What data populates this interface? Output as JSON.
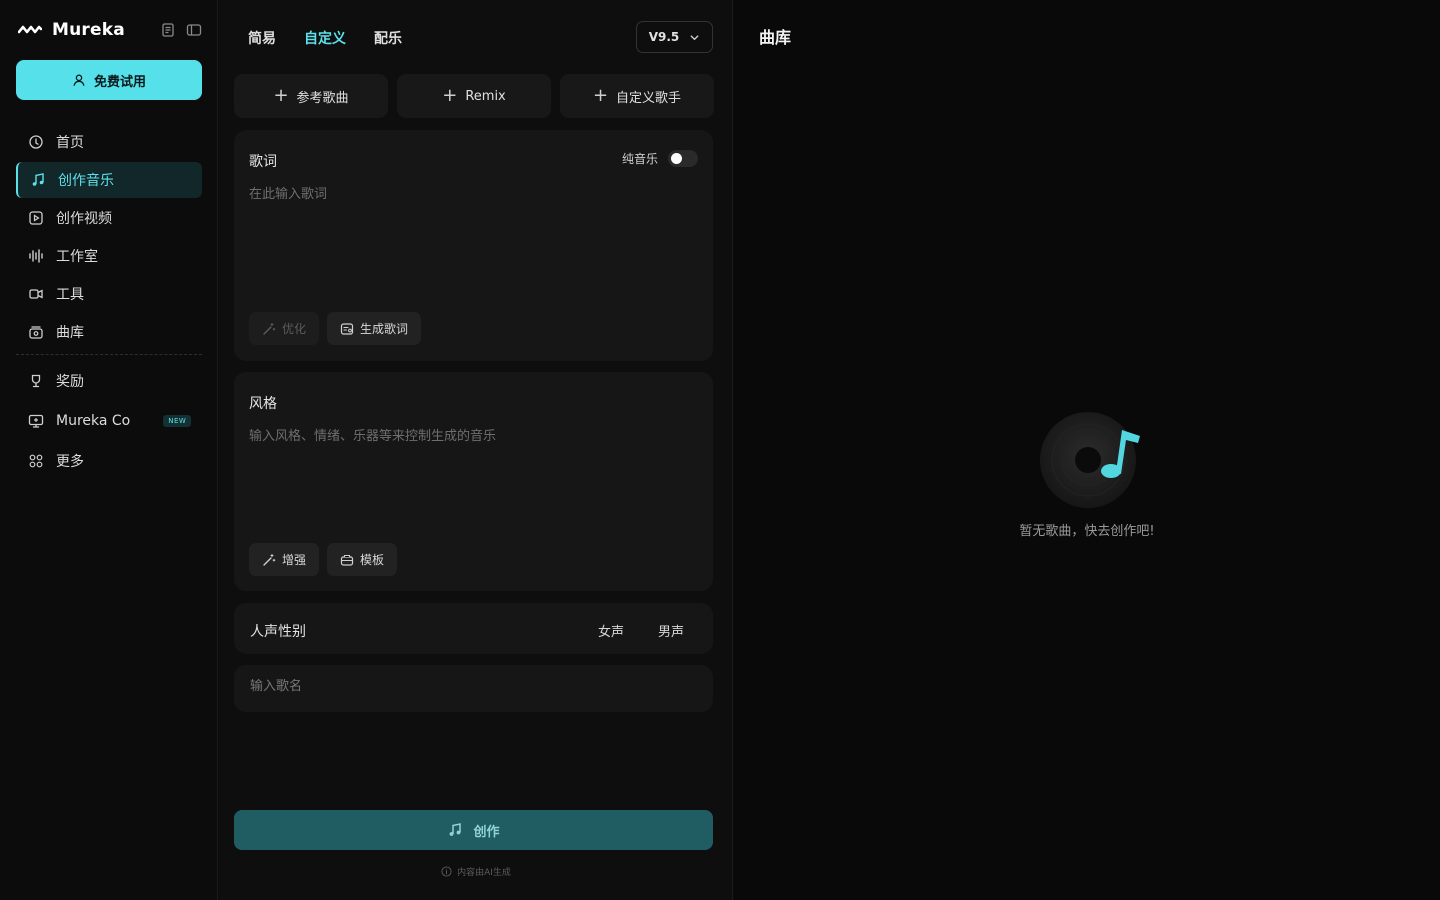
{
  "app": {
    "name": "Mureka",
    "accent": "#5ee0ea"
  },
  "sidebar": {
    "trial_label": "免费试用",
    "items": [
      {
        "label": "首页",
        "icon": "home-icon"
      },
      {
        "label": "创作音乐",
        "icon": "music-note-icon",
        "active": true
      },
      {
        "label": "创作视频",
        "icon": "video-icon"
      },
      {
        "label": "工作室",
        "icon": "waveform-icon"
      },
      {
        "label": "工具",
        "icon": "tools-icon"
      },
      {
        "label": "曲库",
        "icon": "library-icon"
      }
    ],
    "secondary": [
      {
        "label": "奖励",
        "icon": "trophy-icon"
      },
      {
        "label": "Mureka Co",
        "icon": "monitor-icon",
        "badge": "NEW"
      },
      {
        "label": "更多",
        "icon": "grid-icon"
      }
    ]
  },
  "composer": {
    "tabs": [
      "简易",
      "自定义",
      "配乐"
    ],
    "active_tab": "自定义",
    "version": "V9.5",
    "top_buttons": [
      "参考歌曲",
      "Remix",
      "自定义歌手"
    ],
    "lyrics": {
      "title": "歌词",
      "toggle_label": "纯音乐",
      "placeholder": "在此输入歌词",
      "optimize_label": "优化",
      "generate_label": "生成歌词"
    },
    "style": {
      "title": "风格",
      "placeholder": "输入风格、情绪、乐器等来控制生成的音乐",
      "enhance_label": "增强",
      "template_label": "模板"
    },
    "gender": {
      "label": "人声性别",
      "female": "女声",
      "male": "男声"
    },
    "song_name_placeholder": "输入歌名",
    "create_label": "创作",
    "ai_note": "内容由AI生成"
  },
  "library": {
    "title": "曲库",
    "empty_text": "暂无歌曲，快去创作吧!"
  }
}
